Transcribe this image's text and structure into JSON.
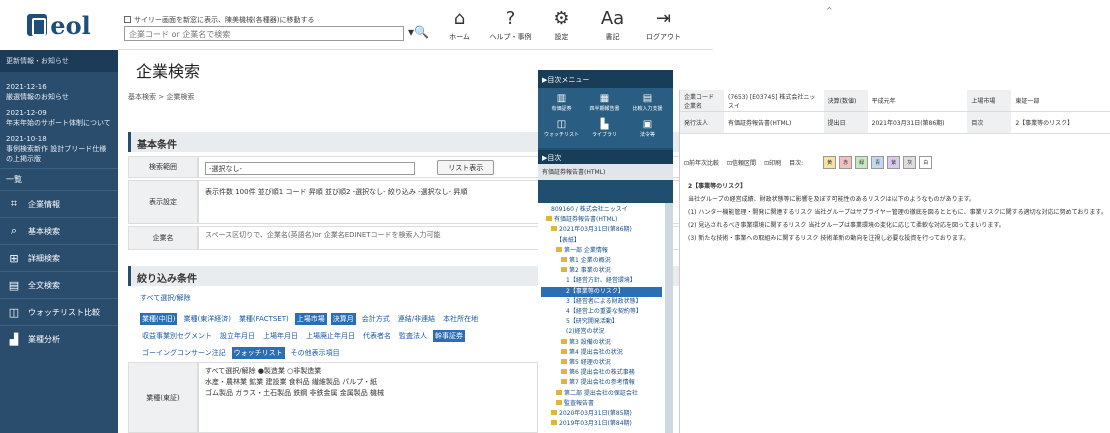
{
  "logo": {
    "text": "eol"
  },
  "topbar": {
    "check": "サイリー画面を新窓に表示、陳美機械(各種器)に移動する",
    "search_placeholder": "企業コード or 企業名で検索",
    "icons": [
      {
        "label": "ホーム",
        "icon": "home-icon",
        "glyph": "⌂"
      },
      {
        "label": "ヘルプ・事例",
        "icon": "help-icon",
        "glyph": "?"
      },
      {
        "label": "設定",
        "icon": "gear-icon",
        "glyph": "⚙"
      },
      {
        "label": "書記",
        "icon": "font-icon",
        "glyph": "Aa"
      },
      {
        "label": "ログアウト",
        "icon": "logout-icon",
        "glyph": "⇥"
      }
    ]
  },
  "sidebar": {
    "header": "更新情報・お知らせ",
    "news": [
      {
        "date": "2021-12-16",
        "text": "厳選情報のお知らせ"
      },
      {
        "date": "2021-12-09",
        "text": "年末年始のサポート体制について"
      },
      {
        "date": "2021-10-18",
        "text": "事例検索新作 設計ブリード仕様の上掲示版"
      }
    ],
    "list_label": "一覧",
    "items": [
      {
        "label": "企業情報",
        "icon": "building-icon",
        "glyph": "⌗"
      },
      {
        "label": "基本検索",
        "icon": "search-icon",
        "glyph": "⌕"
      },
      {
        "label": "詳細検索",
        "icon": "detail-search-icon",
        "glyph": "⊞"
      },
      {
        "label": "全文検索",
        "icon": "fulltext-icon",
        "glyph": "▤"
      },
      {
        "label": "ウォッチリスト比較",
        "icon": "watchlist-icon",
        "glyph": "◫"
      },
      {
        "label": "業種分析",
        "icon": "chart-icon",
        "glyph": "▟"
      }
    ]
  },
  "main": {
    "title": "企業検索",
    "breadcrumb": "基本検索 > 企業検索",
    "basic": {
      "title": "基本条件",
      "rows": [
        {
          "label": "検索範囲",
          "select": "-選択なし-",
          "button": "リスト表示"
        },
        {
          "label": "表示設定",
          "text": "表示件数 100件  並び順1 コード 昇順  並び順2 -選択なし-  絞り込み -選択なし- 昇順"
        },
        {
          "label": "企業名",
          "placeholder": "スペース区切りで、企業名(英語名)or 企業名EDINETコードを検索入力可能"
        }
      ]
    },
    "filter": {
      "title": "絞り込み条件",
      "all": "すべて選択/解除",
      "tags1": [
        {
          "t": "業種(中旧)",
          "on": true
        },
        {
          "t": "業種(東洋経済)",
          "on": false
        },
        {
          "t": "業種(FACTSET)",
          "on": false
        },
        {
          "t": "上場市場",
          "on": true
        },
        {
          "t": "決算月",
          "on": true
        },
        {
          "t": "会計方式",
          "on": false
        },
        {
          "t": "連結/非連結",
          "on": false
        },
        {
          "t": "本社所在地",
          "on": false
        }
      ],
      "tags2": [
        {
          "t": "収益事業別セグメント",
          "on": false
        },
        {
          "t": "設立年月日",
          "on": false
        },
        {
          "t": "上場年月日",
          "on": false
        },
        {
          "t": "上場廃止年月日",
          "on": false
        },
        {
          "t": "代表者名",
          "on": false
        },
        {
          "t": "監査法人",
          "on": false
        },
        {
          "t": "幹事証券",
          "on": true
        }
      ],
      "tags3": [
        {
          "t": "ゴーイングコンサーン注記",
          "on": false
        },
        {
          "t": "ウォッチリスト",
          "on": true
        },
        {
          "t": "その他表示項目",
          "on": false
        }
      ],
      "industry_label": "業種(東証)",
      "industry_head": "すべて選択/解除  ●製造業  ○非製造業",
      "industry_rows": [
        "水産・農林業  鉱業  建設業  食料品  繊維製品  パルプ・紙",
        "ゴム製品  ガラス・土石製品  鉄鋼  非鉄金属  金属製品  機械"
      ]
    }
  },
  "menu": {
    "header": "▶目次メニュー",
    "items": [
      {
        "l": "有価証券",
        "g": "▥"
      },
      {
        "l": "四半期報告書",
        "g": "▦"
      },
      {
        "l": "比較入力支援",
        "g": "▤"
      },
      {
        "l": "ウォッチリスト",
        "g": "◫"
      },
      {
        "l": "ライブラリ",
        "g": "▙"
      },
      {
        "l": "法令等",
        "g": "▣"
      }
    ],
    "toc": "▶目次",
    "doc": "有価証券報告書(HTML)",
    "tree": [
      {
        "t": "809160 / 株式会社ニッスイ",
        "c": ""
      },
      {
        "t": "有価証券報告書(HTML)",
        "c": "fo"
      },
      {
        "t": "2021年03月31日(第86期)",
        "c": "fo"
      },
      {
        "t": "【表紙】",
        "c": ""
      },
      {
        "t": "第一部 企業情報",
        "c": "fo"
      },
      {
        "t": "第1 企業の概況",
        "c": "fo"
      },
      {
        "t": "第2 事業の状況",
        "c": "fo"
      },
      {
        "t": "1【経営方針、経営環境】",
        "c": ""
      },
      {
        "t": "2【事業等のリスク】",
        "c": "sl"
      },
      {
        "t": "3【経営者による財政状態】",
        "c": ""
      },
      {
        "t": "4【経営上の重要な契約等】",
        "c": ""
      },
      {
        "t": "5【研究開発活動】",
        "c": ""
      },
      {
        "t": "(2)経営の状況",
        "c": ""
      },
      {
        "t": "第3 設備の状況",
        "c": "fo"
      },
      {
        "t": "第4 提出会社の状況",
        "c": "fo"
      },
      {
        "t": "第5 経理の状況",
        "c": "fo"
      },
      {
        "t": "第6 提出会社の株式事務",
        "c": "fo"
      },
      {
        "t": "第7 提出会社の参考情報",
        "c": "fo"
      },
      {
        "t": "第二部 提出会社の保証会社",
        "c": "fo"
      },
      {
        "t": "監査報告書",
        "c": "fo"
      },
      {
        "t": "2020年03月31日(第85期)",
        "c": "fo"
      },
      {
        "t": "2019年03月31日(第84期)",
        "c": "fo"
      }
    ]
  },
  "doc": {
    "rows": [
      [
        [
          "企業コード 企業名",
          "(7653) [E03745] 株式会社ニッスイ"
        ],
        [
          "決算(数値)",
          "平成元年"
        ],
        [
          "上場市場",
          "東証一部"
        ]
      ],
      [
        [
          "発行法人",
          "有価証券報告書(HTML)"
        ],
        [
          "提出日",
          "2021年03月31日(第86期)"
        ],
        [
          "目次",
          "2【事業等のリスク】"
        ]
      ]
    ],
    "tools": [
      "前年次比較",
      "信頼区間",
      "印刷"
    ],
    "tools_note": "目次:",
    "colors": [
      "黄",
      "赤",
      "緑",
      "青",
      "紫",
      "灰",
      "白"
    ],
    "paras": [
      "2【事業等のリスク】",
      "当社グループの経営成績、財政状態等に影響を及ぼす可能性のあるリスクは以下のようなものがあります。",
      "(1) ハンター機能管理・開発に関連するリスク 当社グループはサプライヤー管理の徹底を図るとともに、事業リスクに関する適切な対応に努めております。",
      "(2) 見込されるべき事業環境に関するリスク 当社グループは事業環境の変化に応じて柔軟な対応を図ってまいります。",
      "(3) 新たな技術・事業への取組みに関するリスク 技術革新の動向を注視し必要な投資を行っております。"
    ]
  }
}
